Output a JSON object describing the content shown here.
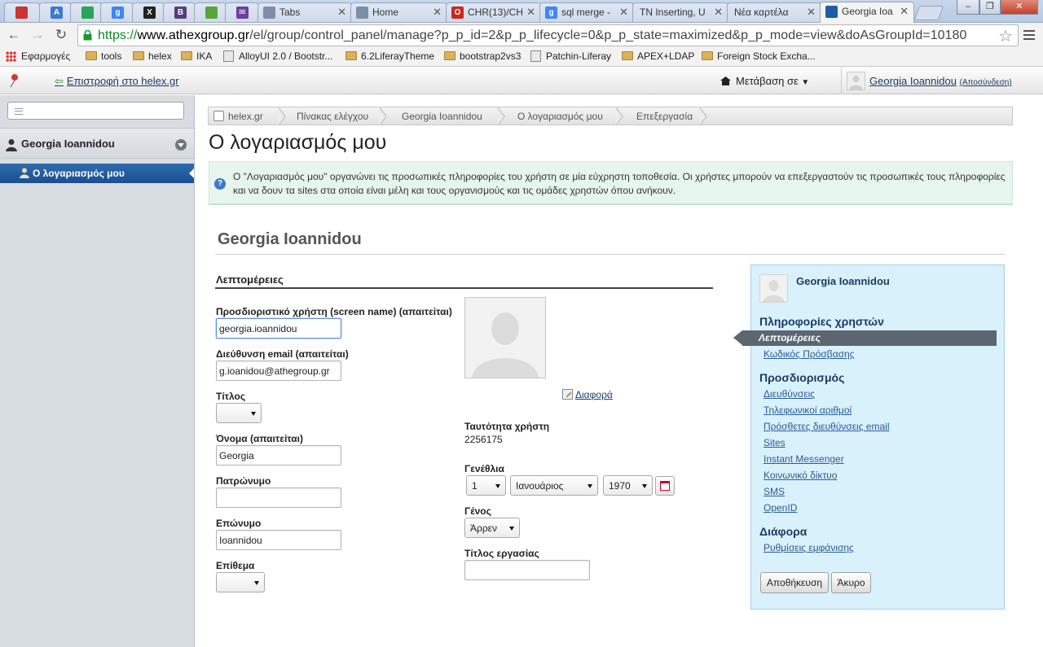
{
  "browser": {
    "tabs": [
      {
        "title": "",
        "fav": "#c33",
        "fav_text": ""
      },
      {
        "title": "",
        "fav": "#3a78d4",
        "fav_text": "A"
      },
      {
        "title": "",
        "fav": "#2aa35b",
        "fav_text": ""
      },
      {
        "title": "",
        "fav": "#4285f4",
        "fav_text": "g"
      },
      {
        "title": "",
        "fav": "#222",
        "fav_text": "X"
      },
      {
        "title": "",
        "fav": "#563d7c",
        "fav_text": "B"
      },
      {
        "title": "",
        "fav": "#5aa53a",
        "fav_text": ""
      },
      {
        "title": "",
        "fav": "#6a3fa0",
        "fav_text": "✉"
      },
      {
        "title": "Tabs",
        "fav": "#7d8fa8",
        "fav_text": ""
      },
      {
        "title": "Home",
        "fav": "#7d8fa8",
        "fav_text": ""
      },
      {
        "title": "CHR(13)/CH",
        "fav": "#c62a1e",
        "fav_text": "O"
      },
      {
        "title": "sql merge -",
        "fav": "#4285f4",
        "fav_text": "g"
      },
      {
        "title": "TN Inserting, U",
        "fav": "",
        "fav_text": ""
      },
      {
        "title": "Νέα καρτέλα",
        "fav": "",
        "fav_text": ""
      },
      {
        "title": "Georgia Ioa",
        "fav": "#1c5fa8",
        "fav_text": ""
      }
    ],
    "url": {
      "https": "https://",
      "host": "www.athexgroup.gr",
      "path": "/el/group/control_panel/manage?p_p_id=2&p_p_lifecycle=0&p_p_state=maximized&p_p_mode=view&doAsGroupId=10180"
    },
    "bookmarks": [
      {
        "label": "Εφαρμογές",
        "icon": "apps-icon"
      },
      {
        "label": "tools",
        "icon": "folder-icon"
      },
      {
        "label": "helex",
        "icon": "folder-icon"
      },
      {
        "label": "IKA",
        "icon": "folder-icon"
      },
      {
        "label": "AlloyUI 2.0 / Bootstr...",
        "icon": "page-icon"
      },
      {
        "label": "6.2LiferayTheme",
        "icon": "folder-icon"
      },
      {
        "label": "bootstrap2vs3",
        "icon": "folder-icon"
      },
      {
        "label": "Patchin-Liferay",
        "icon": "page-icon"
      },
      {
        "label": "APEX+LDAP",
        "icon": "folder-icon"
      },
      {
        "label": "Foreign Stock Excha...",
        "icon": "folder-icon"
      }
    ]
  },
  "dockbar": {
    "back_link": "Επιστροφή στο helex.gr",
    "go_to": "Μετάβαση σε",
    "user": "Georgia Ioannidou",
    "sign_out": "(Αποσύνδεση)"
  },
  "left_nav": {
    "site_name": "Georgia Ioannidou",
    "active_item": "Ο λογαριασμός μου"
  },
  "breadcrumb": [
    "helex.gr",
    "Πίνακας ελέγχου",
    "Georgia Ioannidou",
    "Ο λογαριασμός μου",
    "Επεξεργασία"
  ],
  "page": {
    "title": "Ο λογαριασμός μου",
    "info": "Ο \"Λογαριασμός μου\" οργανώνει τις προσωπικές πληροφορίες του χρήστη σε μία εύχρηστη τοποθεσία. Οι χρήστες μπορούν να επεξεργαστούν τις προσωπικές τους πληροφορίες και να δουν τα sites στα οποία είναι μέλη και τους οργανισμούς και τις ομάδες χρηστών όπου ανήκουν.",
    "user_title": "Georgia Ioannidou",
    "section": "Λεπτομέρειες"
  },
  "form": {
    "screen_name_label": "Προσδιοριστικό χρήστη (screen name) (απαιτείται)",
    "screen_name_value": "georgia.ioannidou",
    "email_label": "Διεύθυνση email (απαιτείται)",
    "email_value": "g.ioanidou@athegroup.gr",
    "title_label": "Τίτλος",
    "title_value": "",
    "first_name_label": "Όνομα (απαιτείται)",
    "first_name_value": "Georgia",
    "middle_name_label": "Πατρώνυμο",
    "middle_name_value": "",
    "last_name_label": "Επώνυμο",
    "last_name_value": "Ioannidou",
    "suffix_label": "Επίθεμα",
    "suffix_value": "",
    "change_portrait": "Διαφορά",
    "user_id_label": "Ταυτότητα χρήστη",
    "user_id_value": "2256175",
    "birthday_label": "Γενέθλια",
    "birthday_day": "1",
    "birthday_month": "Ιανουάριος",
    "birthday_year": "1970",
    "gender_label": "Γένος",
    "gender_value": "Άρρεν",
    "job_title_label": "Τίτλος εργασίας",
    "job_title_value": ""
  },
  "side_panel": {
    "name": "Georgia Ioannidou",
    "user_info_heading": "Πληροφορίες χρηστών",
    "user_info_links": [
      "Λεπτομέρειες",
      "Κωδικός Πρόσβασης"
    ],
    "identification_heading": "Προσδιορισμός",
    "identification_links": [
      "Διευθύνσεις",
      "Τηλεφωνικοί αριθμοί",
      "Πρόσθετες διευθύνσεις email",
      "Sites",
      "Instant Messenger",
      "Κοινωνικό δίκτυο",
      "SMS",
      "OpenID"
    ],
    "misc_heading": "Διάφορα",
    "misc_links": [
      "Ρυθμίσεις εμφάνισης"
    ],
    "save": "Αποθήκευση",
    "cancel": "Άκυρο"
  }
}
